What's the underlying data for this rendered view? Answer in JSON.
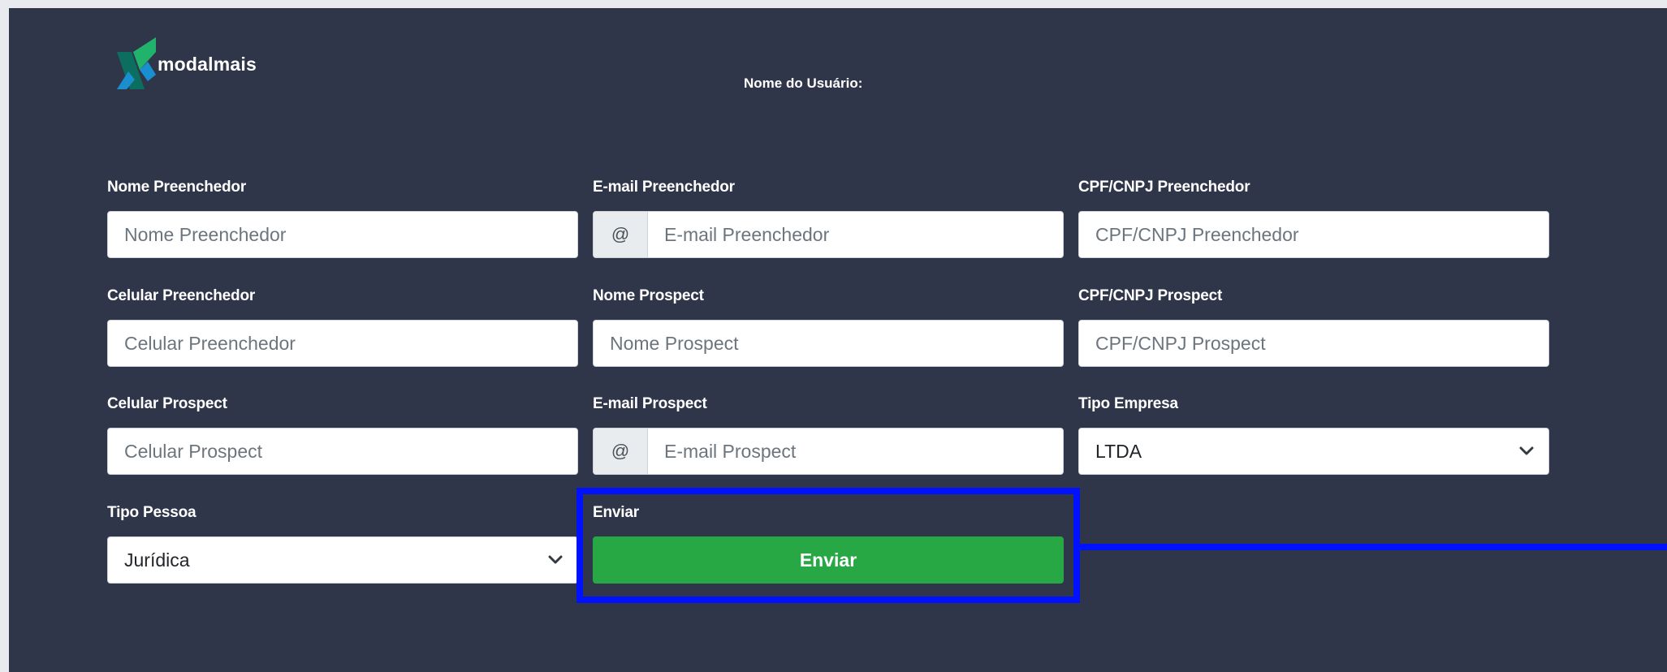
{
  "brand": {
    "logo_text": "modalmais",
    "colors": {
      "logo_dark_teal": "#0b6e5e",
      "logo_green": "#21b36b",
      "logo_blue": "#1a8fd0",
      "panel_bg": "#30364a",
      "button_green": "#28a745",
      "highlight_blue": "#0011ff"
    }
  },
  "header": {
    "user_label": "Nome do Usuário:"
  },
  "form": {
    "nome_preenchedor": {
      "label": "Nome Preenchedor",
      "placeholder": "Nome Preenchedor"
    },
    "email_preenchedor": {
      "label": "E-mail Preenchedor",
      "addon": "@",
      "placeholder": "E-mail Preenchedor"
    },
    "cpf_preenchedor": {
      "label": "CPF/CNPJ Preenchedor",
      "placeholder": "CPF/CNPJ Preenchedor"
    },
    "celular_preenchedor": {
      "label": "Celular Preenchedor",
      "placeholder": "Celular Preenchedor"
    },
    "nome_prospect": {
      "label": "Nome Prospect",
      "placeholder": "Nome Prospect"
    },
    "cpf_prospect": {
      "label": "CPF/CNPJ Prospect",
      "placeholder": "CPF/CNPJ Prospect"
    },
    "celular_prospect": {
      "label": "Celular Prospect",
      "placeholder": "Celular Prospect"
    },
    "email_prospect": {
      "label": "E-mail Prospect",
      "addon": "@",
      "placeholder": "E-mail Prospect"
    },
    "tipo_empresa": {
      "label": "Tipo Empresa",
      "value": "LTDA",
      "icon": "chevron-down-icon"
    },
    "tipo_pessoa": {
      "label": "Tipo Pessoa",
      "value": "Jurídica",
      "icon": "chevron-down-icon"
    },
    "enviar": {
      "label": "Enviar",
      "button_label": "Enviar"
    }
  }
}
